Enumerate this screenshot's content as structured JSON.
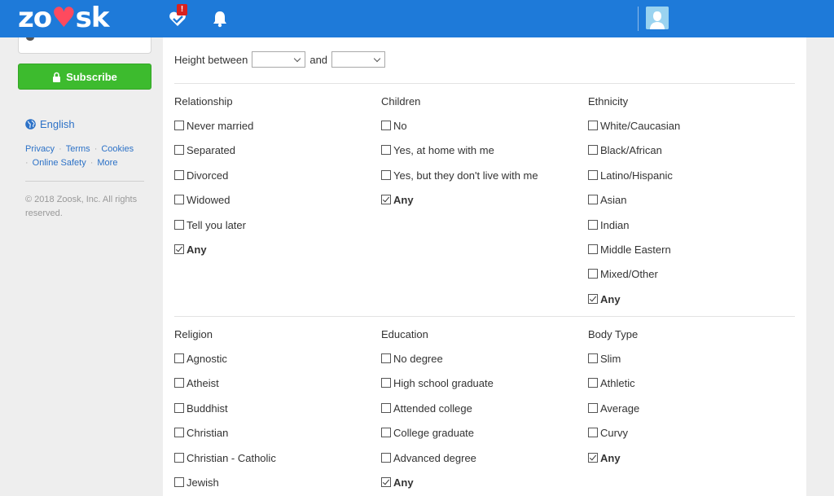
{
  "header": {
    "logo": "zoosk",
    "matches_badge": "!"
  },
  "sidebar": {
    "subscribe_label": "Subscribe",
    "language": "English",
    "links": [
      "Privacy",
      "Terms",
      "Cookies",
      "Online Safety",
      "More"
    ],
    "copyright": "© 2018 Zoosk, Inc. All rights reserved."
  },
  "filters": {
    "height_label": "Height between",
    "height_and": "and",
    "height_min": "",
    "height_max": "",
    "relationship": {
      "title": "Relationship",
      "options": [
        {
          "label": "Never married",
          "checked": false
        },
        {
          "label": "Separated",
          "checked": false
        },
        {
          "label": "Divorced",
          "checked": false
        },
        {
          "label": "Widowed",
          "checked": false
        },
        {
          "label": "Tell you later",
          "checked": false
        },
        {
          "label": "Any",
          "checked": true
        }
      ]
    },
    "children": {
      "title": "Children",
      "options": [
        {
          "label": "No",
          "checked": false
        },
        {
          "label": "Yes, at home with me",
          "checked": false
        },
        {
          "label": "Yes, but they don't live with me",
          "checked": false
        },
        {
          "label": "Any",
          "checked": true
        }
      ]
    },
    "ethnicity": {
      "title": "Ethnicity",
      "options": [
        {
          "label": "White/Caucasian",
          "checked": false
        },
        {
          "label": "Black/African",
          "checked": false
        },
        {
          "label": "Latino/Hispanic",
          "checked": false
        },
        {
          "label": "Asian",
          "checked": false
        },
        {
          "label": "Indian",
          "checked": false
        },
        {
          "label": "Middle Eastern",
          "checked": false
        },
        {
          "label": "Mixed/Other",
          "checked": false
        },
        {
          "label": "Any",
          "checked": true
        }
      ]
    },
    "religion": {
      "title": "Religion",
      "options": [
        {
          "label": "Agnostic",
          "checked": false
        },
        {
          "label": "Atheist",
          "checked": false
        },
        {
          "label": "Buddhist",
          "checked": false
        },
        {
          "label": "Christian",
          "checked": false
        },
        {
          "label": "Christian - Catholic",
          "checked": false
        },
        {
          "label": "Jewish",
          "checked": false
        }
      ]
    },
    "education": {
      "title": "Education",
      "options": [
        {
          "label": "No degree",
          "checked": false
        },
        {
          "label": "High school graduate",
          "checked": false
        },
        {
          "label": "Attended college",
          "checked": false
        },
        {
          "label": "College graduate",
          "checked": false
        },
        {
          "label": "Advanced degree",
          "checked": false
        },
        {
          "label": "Any",
          "checked": true
        }
      ]
    },
    "body_type": {
      "title": "Body Type",
      "options": [
        {
          "label": "Slim",
          "checked": false
        },
        {
          "label": "Athletic",
          "checked": false
        },
        {
          "label": "Average",
          "checked": false
        },
        {
          "label": "Curvy",
          "checked": false
        },
        {
          "label": "Any",
          "checked": true
        }
      ]
    }
  },
  "icons": {
    "matches": "heart-check-icon",
    "notifications": "bell-icon",
    "profile": "avatar-icon",
    "lock": "lock-icon",
    "globe": "globe-icon"
  },
  "colors": {
    "header": "#1e7ad9",
    "subscribe": "#3dbb2e",
    "link": "#2d72c7",
    "badge": "#d9221f"
  }
}
